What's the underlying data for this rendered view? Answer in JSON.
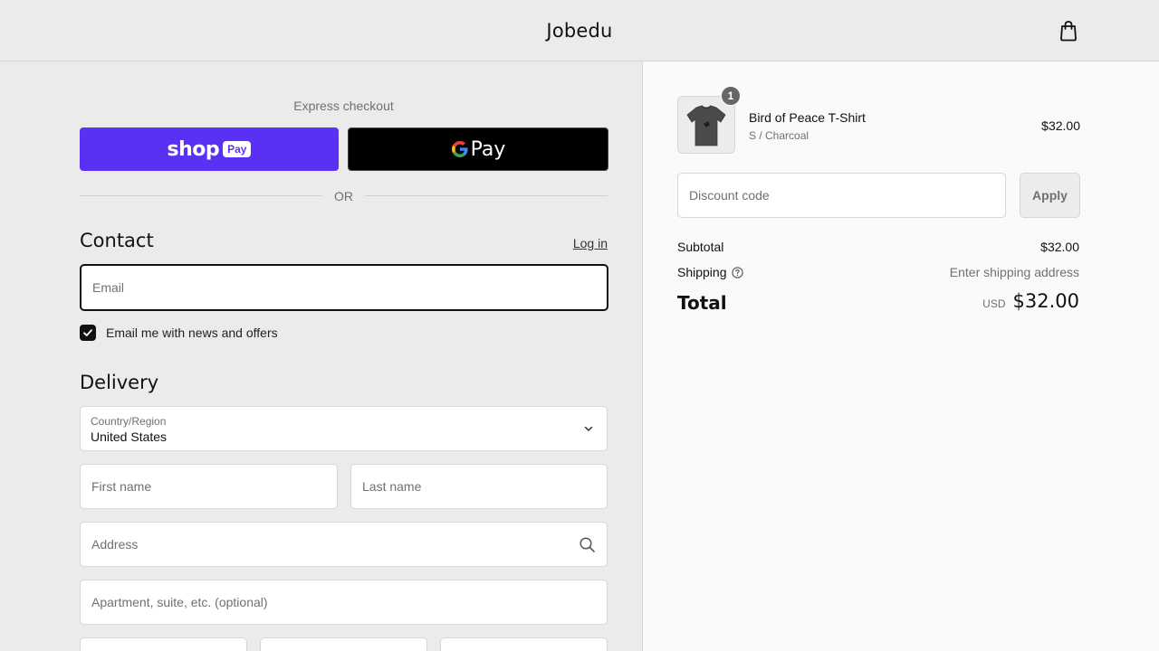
{
  "header": {
    "brand": "Jobedu",
    "cart_icon": "shopping-bag-icon"
  },
  "express": {
    "label": "Express checkout",
    "shop_pay": {
      "brand": "shop",
      "pill": "Pay",
      "color": "#5a31f4"
    },
    "google_pay": {
      "label": "Pay",
      "color": "#000000"
    },
    "divider": "OR"
  },
  "contact": {
    "title": "Contact",
    "login_label": "Log in",
    "email_placeholder": "Email",
    "news_checkbox_label": "Email me with news and offers",
    "news_checked": true
  },
  "delivery": {
    "title": "Delivery",
    "country_label": "Country/Region",
    "country_value": "United States",
    "first_name_placeholder": "First name",
    "last_name_placeholder": "Last name",
    "address_placeholder": "Address",
    "apartment_placeholder": "Apartment, suite, etc. (optional)"
  },
  "summary": {
    "item": {
      "quantity": "1",
      "name": "Bird of Peace T-Shirt",
      "variant": "S / Charcoal",
      "price": "$32.00"
    },
    "discount_placeholder": "Discount code",
    "apply_label": "Apply",
    "subtotal_label": "Subtotal",
    "subtotal_value": "$32.00",
    "shipping_label": "Shipping",
    "shipping_value": "Enter shipping address",
    "total_label": "Total",
    "total_currency": "USD",
    "total_value": "$32.00"
  }
}
